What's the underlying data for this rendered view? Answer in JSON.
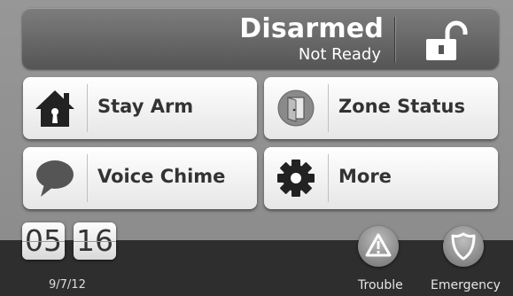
{
  "status": {
    "title": "Disarmed",
    "subtitle": "Not Ready",
    "lock_icon": "unlocked-padlock-icon"
  },
  "buttons": [
    {
      "label": "Stay Arm",
      "icon": "house-icon"
    },
    {
      "label": "Zone Status",
      "icon": "door-icon"
    },
    {
      "label": "Voice Chime",
      "icon": "speech-bubble-icon"
    },
    {
      "label": "More",
      "icon": "gear-icon"
    }
  ],
  "clock": {
    "hours": "05",
    "minutes": "16",
    "date": "9/7/12"
  },
  "bottom": {
    "trouble_label": "Trouble",
    "trouble_icon": "warning-triangle-icon",
    "emergency_label": "Emergency",
    "emergency_icon": "shield-icon"
  }
}
